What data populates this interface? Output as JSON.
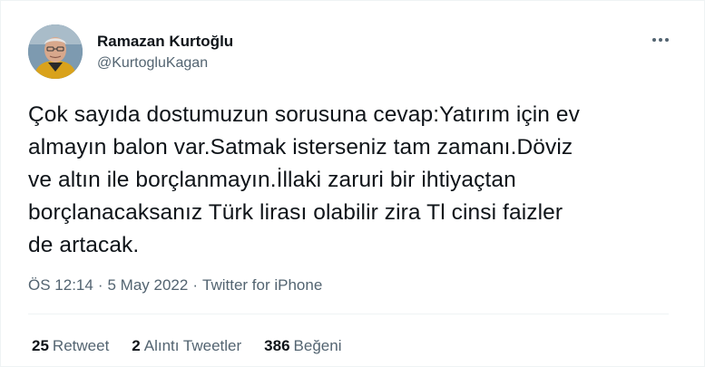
{
  "user": {
    "display_name": "Ramazan Kurtoğlu",
    "handle": "@KurtogluKagan"
  },
  "tweet": {
    "text": "Çok sayıda dostumuzun sorusuna cevap:Yatırım için ev\nalmayın balon var.Satmak isterseniz tam zamanı.Döviz\nve altın ile borçlanmayın.İllaki zaruri bir ihtiyaçtan\nborçlanacaksanız Türk lirası olabilir zira Tl cinsi faizler\nde artacak."
  },
  "meta": {
    "time": "ÖS 12:14",
    "separator": "·",
    "date": "5 May 2022",
    "source": "Twitter for iPhone"
  },
  "stats": {
    "retweets_count": "25",
    "retweets_label": "Retweet",
    "quotes_count": "2",
    "quotes_label": "Alıntı Tweetler",
    "likes_count": "386",
    "likes_label": "Beğeni"
  },
  "icons": {
    "more": "more-horizontal-icon"
  }
}
